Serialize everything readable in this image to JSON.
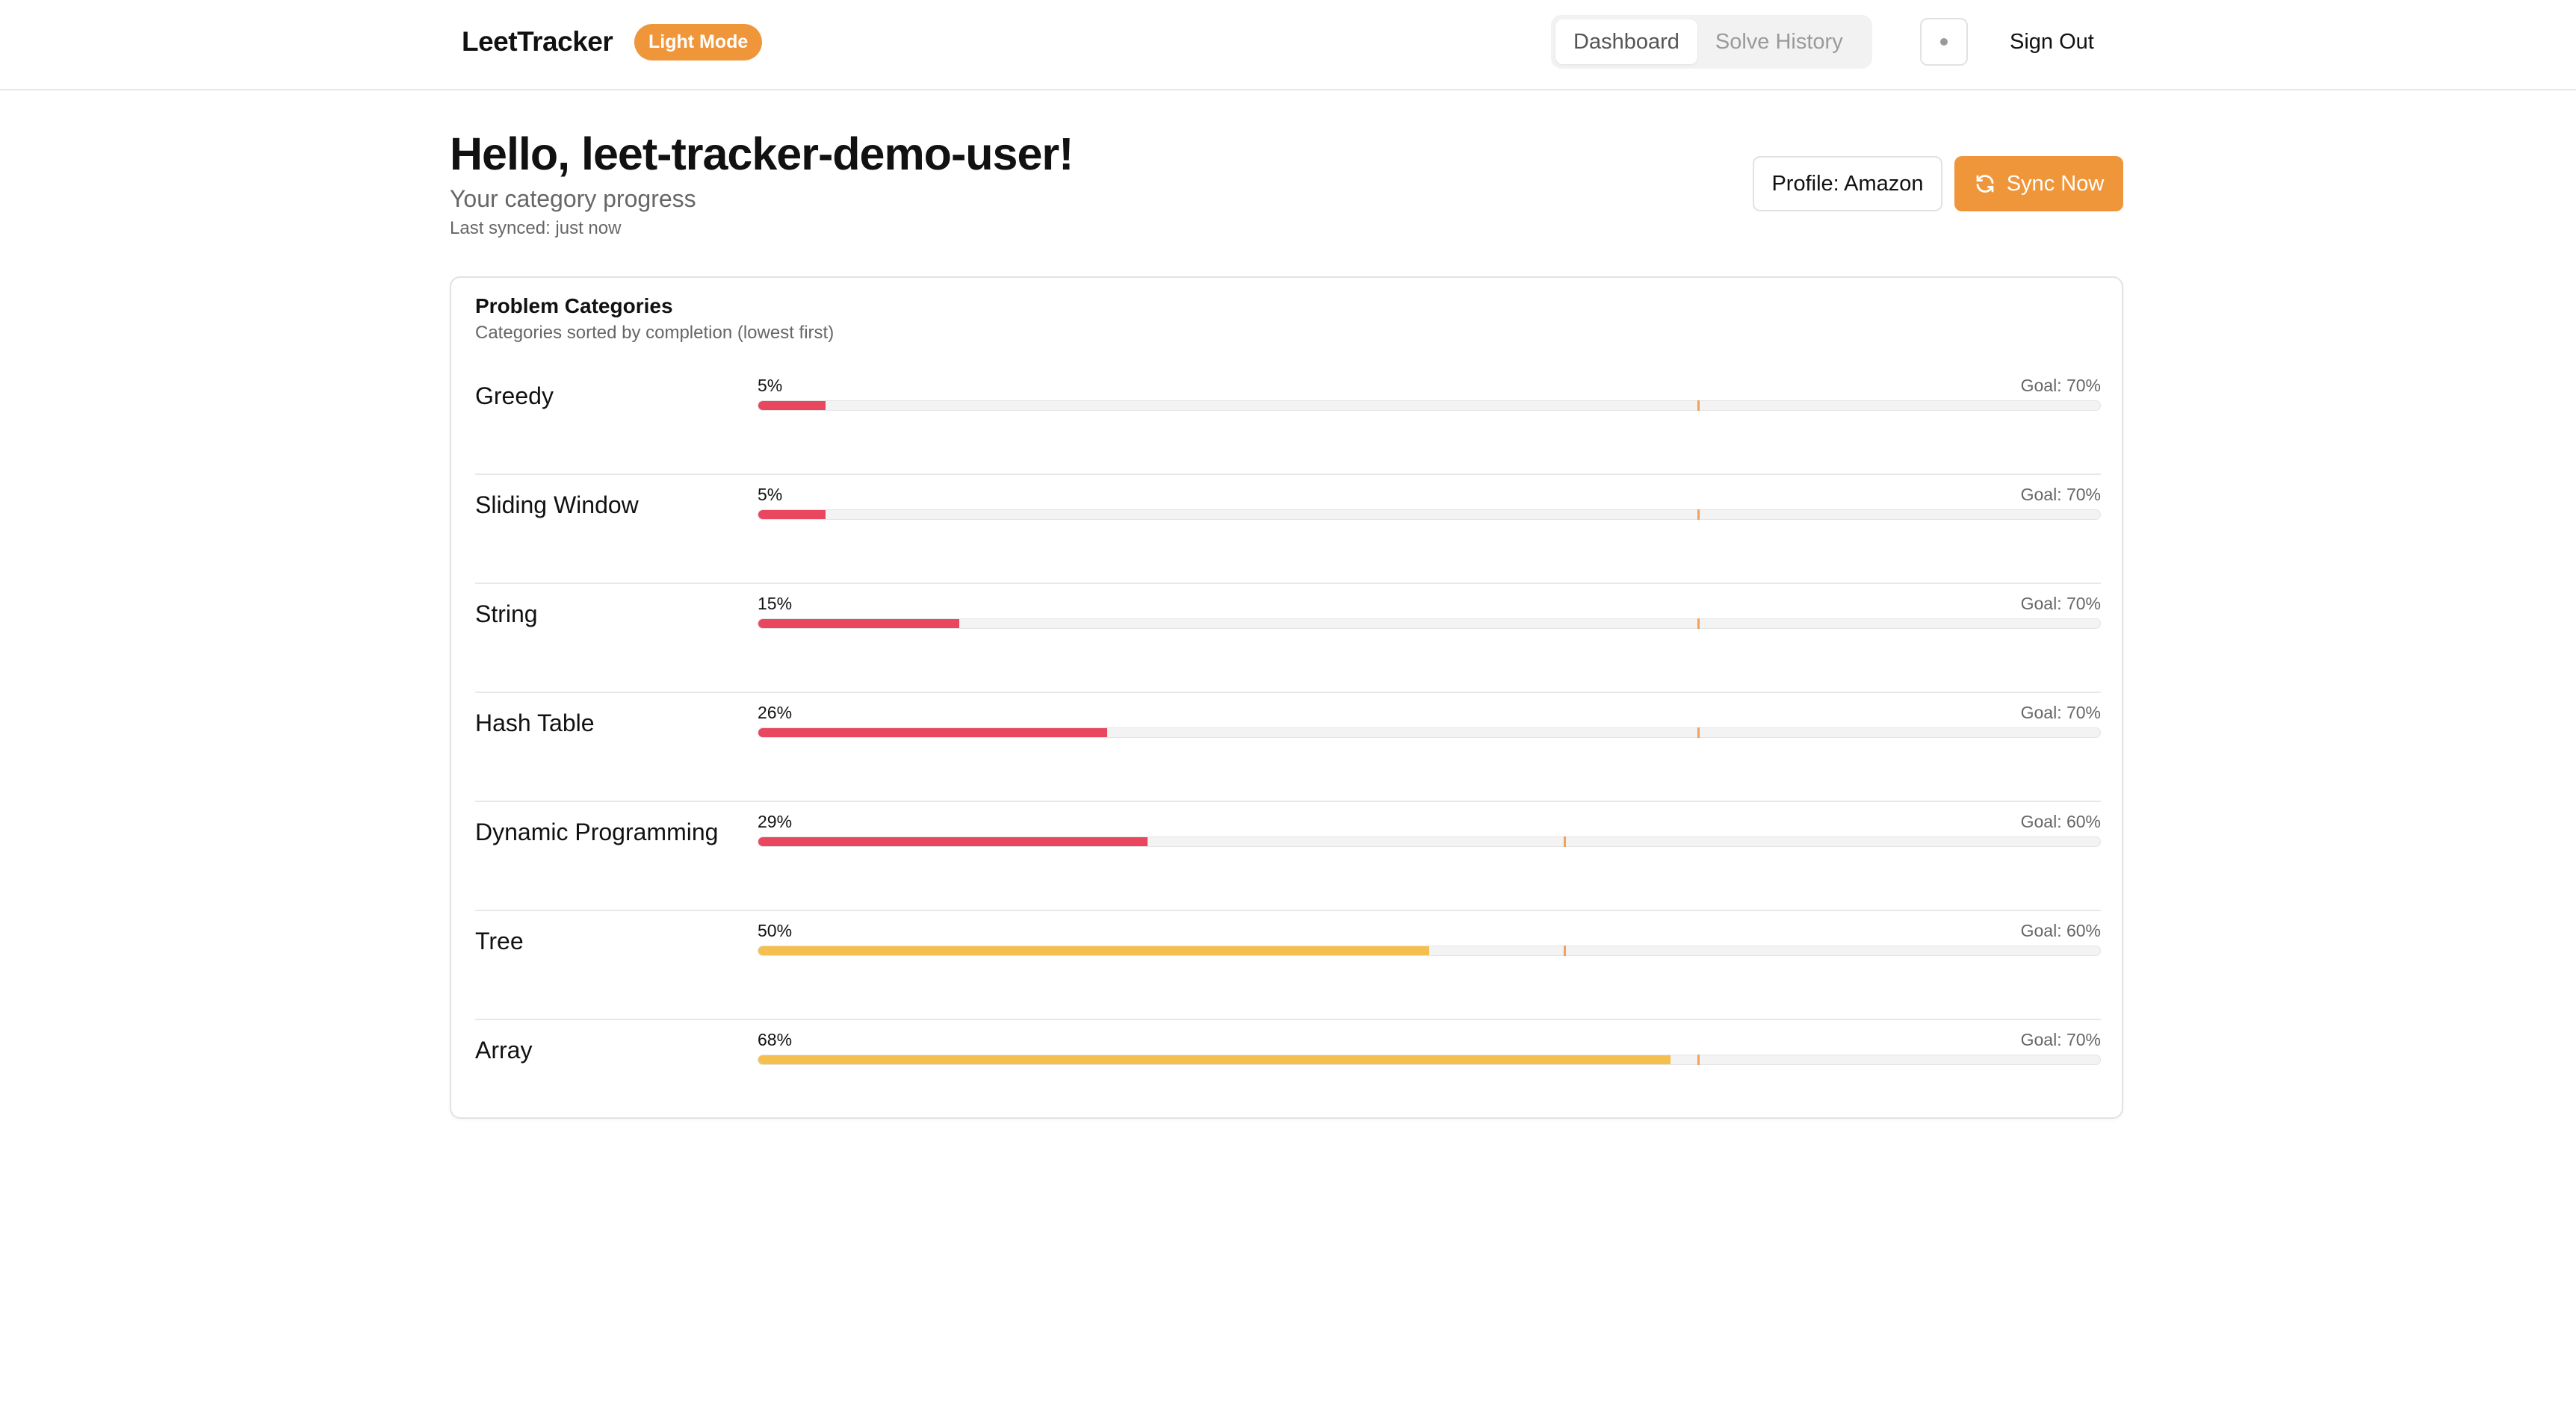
{
  "nav": {
    "brand": "LeetTracker",
    "mode_badge": "Light Mode",
    "tabs": [
      "Dashboard",
      "Solve History"
    ],
    "active_tab": "Dashboard",
    "theme_toggle_icon": "theme-toggle-icon",
    "sign_out": "Sign Out"
  },
  "header": {
    "greeting": "Hello, leet-tracker-demo-user!",
    "subtitle": "Your category progress",
    "last_synced": "Last synced: just now",
    "profile_button": "Profile: Amazon",
    "sync_button": "Sync Now",
    "sync_icon": "refresh-icon"
  },
  "colors": {
    "accent": "#f0963a",
    "low": "#e8475f",
    "mid": "#f5bf4f",
    "goal_marker": "#f2a15c"
  },
  "categories_card": {
    "title": "Problem Categories",
    "subtitle": "Categories sorted by completion (lowest first)",
    "rows": [
      {
        "name": "Greedy",
        "percent_label": "5%",
        "progress": 0.05,
        "goal_label": "Goal: 70%",
        "goal": 0.7,
        "status": "low"
      },
      {
        "name": "Sliding Window",
        "percent_label": "5%",
        "progress": 0.05,
        "goal_label": "Goal: 70%",
        "goal": 0.7,
        "status": "low"
      },
      {
        "name": "String",
        "percent_label": "15%",
        "progress": 0.15,
        "goal_label": "Goal: 70%",
        "goal": 0.7,
        "status": "low"
      },
      {
        "name": "Hash Table",
        "percent_label": "26%",
        "progress": 0.26,
        "goal_label": "Goal: 70%",
        "goal": 0.7,
        "status": "low"
      },
      {
        "name": "Dynamic Programming",
        "percent_label": "29%",
        "progress": 0.29,
        "goal_label": "Goal: 60%",
        "goal": 0.6,
        "status": "low"
      },
      {
        "name": "Tree",
        "percent_label": "50%",
        "progress": 0.5,
        "goal_label": "Goal: 60%",
        "goal": 0.6,
        "status": "mid"
      },
      {
        "name": "Array",
        "percent_label": "68%",
        "progress": 0.68,
        "goal_label": "Goal: 70%",
        "goal": 0.7,
        "status": "mid"
      }
    ]
  }
}
